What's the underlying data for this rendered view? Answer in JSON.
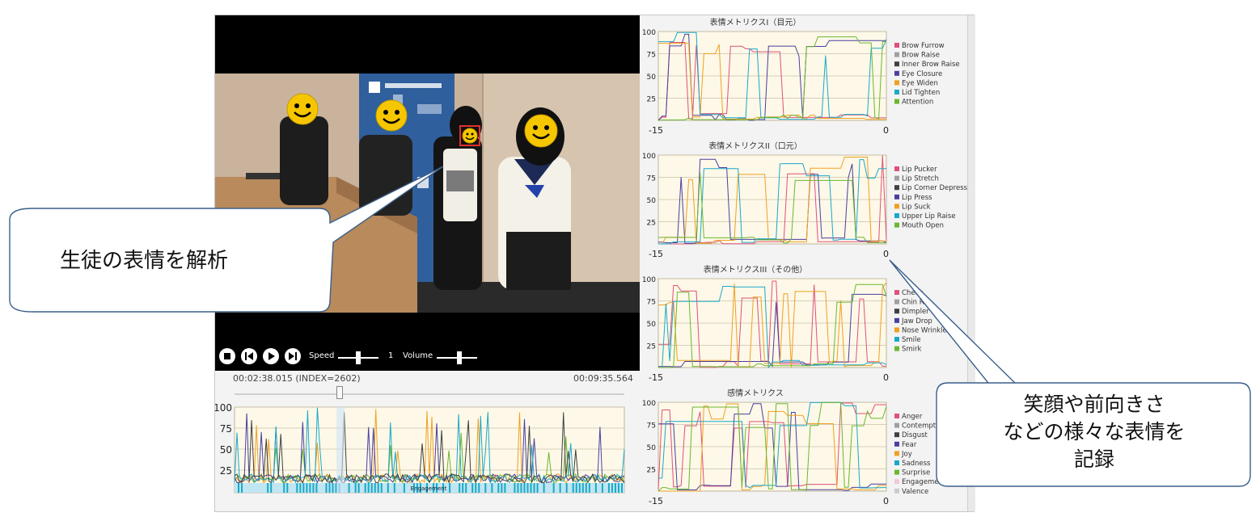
{
  "player": {
    "speed_label": "Speed",
    "speed_value": "1",
    "volume_label": "Volume",
    "current_time": "00:02:38.015 (INDEX=2602)",
    "total_time": "00:09:35.564",
    "seek_position": 0.27,
    "speed_level": 0.5,
    "volume_level": 0.55
  },
  "timeline": {
    "yticks": [
      "100",
      "75",
      "50",
      "25"
    ],
    "engagement_label": "Engagement"
  },
  "charts": {
    "eyes": {
      "title": "表情メトリクスI（目元）",
      "legend": [
        {
          "name": "Brow Furrow",
          "color": "#e0507a"
        },
        {
          "name": "Brow Raise",
          "color": "#a0a0a0"
        },
        {
          "name": "Inner Brow Raise",
          "color": "#404040"
        },
        {
          "name": "Eye Closure",
          "color": "#4a3fa0"
        },
        {
          "name": "Eye Widen",
          "color": "#f0a020"
        },
        {
          "name": "Lid Tighten",
          "color": "#1aa8c8"
        },
        {
          "name": "Attention",
          "color": "#6ab830"
        }
      ],
      "yticks": [
        "100",
        "75",
        "50",
        "25"
      ],
      "xmin": "-15",
      "xmax": "0"
    },
    "mouth": {
      "title": "表情メトリクスII（口元）",
      "legend": [
        {
          "name": "Lip Pucker",
          "color": "#e0507a"
        },
        {
          "name": "Lip Stretch",
          "color": "#a0a0a0"
        },
        {
          "name": "Lip Corner Depressor",
          "color": "#404040"
        },
        {
          "name": "Lip Press",
          "color": "#4a3fa0"
        },
        {
          "name": "Lip Suck",
          "color": "#f0a020"
        },
        {
          "name": "Upper Lip Raise",
          "color": "#1aa8c8"
        },
        {
          "name": "Mouth Open",
          "color": "#6ab830"
        }
      ],
      "yticks": [
        "100",
        "75",
        "50",
        "25"
      ],
      "xmin": "-15",
      "xmax": "0"
    },
    "other": {
      "title": "表情メトリクスIII（その他）",
      "legend": [
        {
          "name": "Cheek",
          "color": "#e0507a"
        },
        {
          "name": "Chin Rai",
          "color": "#a0a0a0"
        },
        {
          "name": "Dimpler",
          "color": "#404040"
        },
        {
          "name": "Jaw Drop",
          "color": "#4a3fa0"
        },
        {
          "name": "Nose Wrinkle",
          "color": "#f0a020"
        },
        {
          "name": "Smile",
          "color": "#1aa8c8"
        },
        {
          "name": "Smirk",
          "color": "#6ab830"
        }
      ],
      "yticks": [
        "100",
        "75",
        "50",
        "25"
      ],
      "xmin": "-15",
      "xmax": "0"
    },
    "emotion": {
      "title": "感情メトリクス",
      "legend": [
        {
          "name": "Anger",
          "color": "#e0507a"
        },
        {
          "name": "Contempt",
          "color": "#a0a0a0"
        },
        {
          "name": "Disgust",
          "color": "#404040"
        },
        {
          "name": "Fear",
          "color": "#4a3fa0"
        },
        {
          "name": "Joy",
          "color": "#f0a020"
        },
        {
          "name": "Sadness",
          "color": "#1aa8c8"
        },
        {
          "name": "Surprise",
          "color": "#6ab830"
        },
        {
          "name": "Engagement",
          "color": "#f3c8d8"
        },
        {
          "name": "Valence",
          "color": "#cccccc"
        }
      ],
      "yticks": [
        "100",
        "75",
        "50",
        "25"
      ],
      "xmin": "-15",
      "xmax": "0"
    }
  },
  "callouts": {
    "left": "生徒の表情を解析",
    "right_lines": [
      "笑顔や前向きさ",
      "などの様々な表情を",
      "記録"
    ]
  },
  "colors": {
    "plot_bg": "#fdf8e8",
    "grid": "#c9c2a8",
    "callout_border": "#3a5f8a",
    "face_yellow": "#f6c700",
    "tracking_box": "#e03030"
  }
}
